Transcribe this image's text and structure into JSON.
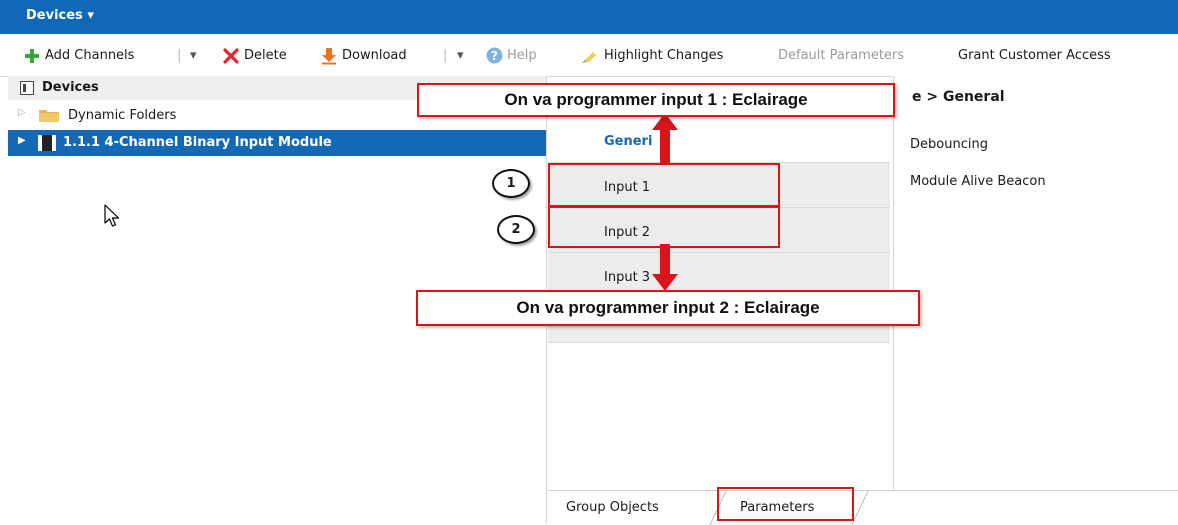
{
  "titlebar": {
    "title": "Devices ▾"
  },
  "toolbar": {
    "add_channels": "Add Channels",
    "delete": "Delete",
    "download": "Download",
    "help": "Help",
    "highlight_changes": "Highlight Changes",
    "default_parameters": "Default Parameters",
    "grant_customer_access": "Grant Customer Access",
    "dropdown_glyph": "▾",
    "separator": "|"
  },
  "left": {
    "header": "Devices",
    "folder": "Dynamic Folders",
    "selected_device": "1.1.1 4-Channel Binary Input Module"
  },
  "middle": {
    "general": "Generi",
    "input1": "Input 1",
    "input2": "Input 2",
    "input3": "Input 3"
  },
  "right": {
    "breadcrumb": "e > General",
    "param1": "Debouncing",
    "param2": "Module Alive Beacon"
  },
  "bottom": {
    "tab_group_objects": "Group Objects",
    "tab_parameters": "Parameters"
  },
  "annotations": {
    "callout_top": "On va programmer input 1 : Eclairage",
    "callout_bottom": "On va programmer input 2 : Eclairage",
    "marker1": "1",
    "marker2": "2"
  },
  "colors": {
    "accent": "#1167b8",
    "selection": "#1469b6",
    "annotation_red": "#d9141b",
    "add_green": "#3aa335",
    "delete_red": "#e0282e",
    "download_orange": "#e8731c"
  }
}
